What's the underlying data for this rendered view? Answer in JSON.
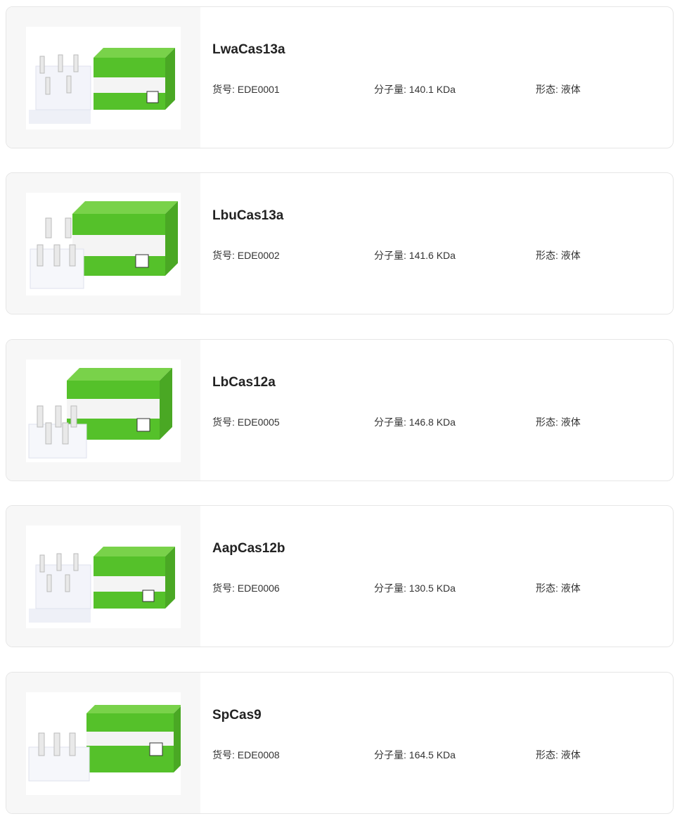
{
  "labels": {
    "catalog": "货号:",
    "mw": "分子量:",
    "form": "形态:"
  },
  "colors": {
    "brand_green": "#55c12a",
    "card_border": "#e6e6e6",
    "thumb_bg": "#f7f7f7"
  },
  "products": [
    {
      "name": "LwaCas13a",
      "catalog": "EDE0001",
      "mw": "140.1 KDa",
      "form": "液体",
      "image": "kit-box-with-tube-rack-image"
    },
    {
      "name": "LbuCas13a",
      "catalog": "EDE0002",
      "mw": "141.6 KDa",
      "form": "液体",
      "image": "kit-box-with-tube-rack-image"
    },
    {
      "name": "LbCas12a",
      "catalog": "EDE0005",
      "mw": "146.8 KDa",
      "form": "液体",
      "image": "kit-box-with-tube-rack-image"
    },
    {
      "name": "AapCas12b",
      "catalog": "EDE0006",
      "mw": "130.5 KDa",
      "form": "液体",
      "image": "kit-box-with-tube-rack-image"
    },
    {
      "name": "SpCas9",
      "catalog": "EDE0008",
      "mw": "164.5 KDa",
      "form": "液体",
      "image": "kit-box-with-tube-rack-image"
    }
  ]
}
